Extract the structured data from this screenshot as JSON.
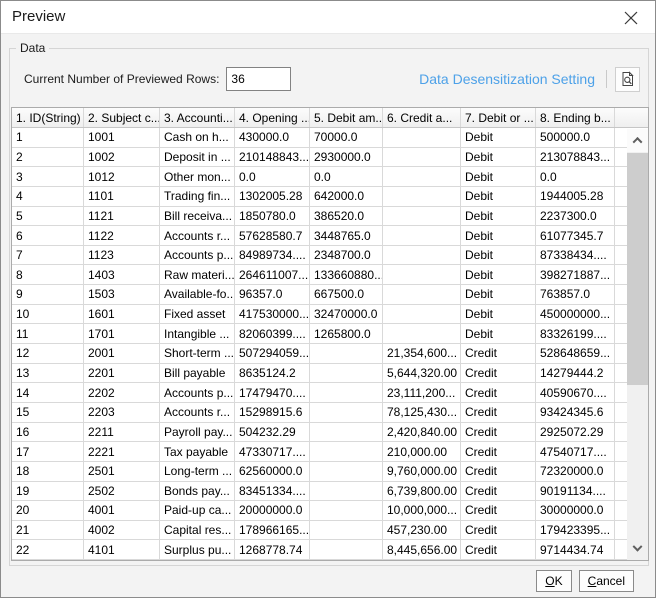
{
  "window": {
    "title": "Preview"
  },
  "groupbox_label": "Data",
  "toolbar": {
    "rows_label": "Current Number of Previewed Rows:",
    "rows_value": "36",
    "desensitization_link": "Data Desensitization Setting"
  },
  "table": {
    "headers": [
      "1. ID(String)",
      "2. Subject c...",
      "3. Accounti...",
      "4. Opening ...",
      "5. Debit am...",
      "6. Credit a...",
      "7. Debit or ...",
      "8. Ending b..."
    ],
    "rows": [
      [
        "1",
        "1001",
        "Cash on h...",
        "430000.0",
        "70000.0",
        "",
        "Debit",
        "500000.0"
      ],
      [
        "2",
        "1002",
        "Deposit in ...",
        "210148843...",
        "2930000.0",
        "",
        "Debit",
        "213078843..."
      ],
      [
        "3",
        "1012",
        "Other mon...",
        "0.0",
        "0.0",
        "",
        "Debit",
        "0.0"
      ],
      [
        "4",
        "1101",
        "Trading fin...",
        "1302005.28",
        "642000.0",
        "",
        "Debit",
        "1944005.28"
      ],
      [
        "5",
        "1121",
        "Bill receiva...",
        "1850780.0",
        "386520.0",
        "",
        "Debit",
        "2237300.0"
      ],
      [
        "6",
        "1122",
        "Accounts r...",
        "57628580.7",
        "3448765.0",
        "",
        "Debit",
        "61077345.7"
      ],
      [
        "7",
        "1123",
        "Accounts p...",
        "84989734....",
        "2348700.0",
        "",
        "Debit",
        "87338434...."
      ],
      [
        "8",
        "1403",
        "Raw materi...",
        "264611007...",
        "133660880...",
        "",
        "Debit",
        "398271887..."
      ],
      [
        "9",
        "1503",
        "Available-fo...",
        "96357.0",
        "667500.0",
        "",
        "Debit",
        "763857.0"
      ],
      [
        "10",
        "1601",
        "Fixed asset",
        "417530000...",
        "32470000.0",
        "",
        "Debit",
        "450000000..."
      ],
      [
        "11",
        "1701",
        "Intangible ...",
        "82060399....",
        "1265800.0",
        "",
        "Debit",
        "83326199...."
      ],
      [
        "12",
        "2001",
        "Short-term ...",
        "507294059...",
        "",
        "21,354,600...",
        "Credit",
        "528648659..."
      ],
      [
        "13",
        "2201",
        "Bill payable",
        "8635124.2",
        "",
        "5,644,320.00",
        "Credit",
        "14279444.2"
      ],
      [
        "14",
        "2202",
        "Accounts p...",
        "17479470....",
        "",
        "23,111,200...",
        "Credit",
        "40590670...."
      ],
      [
        "15",
        "2203",
        "Accounts r...",
        "15298915.6",
        "",
        "78,125,430...",
        "Credit",
        "93424345.6"
      ],
      [
        "16",
        "2211",
        "Payroll pay...",
        "504232.29",
        "",
        "2,420,840.00",
        "Credit",
        "2925072.29"
      ],
      [
        "17",
        "2221",
        "Tax payable",
        "47330717....",
        "",
        "210,000.00",
        "Credit",
        "47540717...."
      ],
      [
        "18",
        "2501",
        "Long-term ...",
        "62560000.0",
        "",
        "9,760,000.00",
        "Credit",
        "72320000.0"
      ],
      [
        "19",
        "2502",
        "Bonds pay...",
        "83451334....",
        "",
        "6,739,800.00",
        "Credit",
        "90191134...."
      ],
      [
        "20",
        "4001",
        "Paid-up ca...",
        "20000000.0",
        "",
        "10,000,000...",
        "Credit",
        "30000000.0"
      ],
      [
        "21",
        "4002",
        "Capital res...",
        "178966165...",
        "",
        "457,230.00",
        "Credit",
        "179423395..."
      ],
      [
        "22",
        "4101",
        "Surplus pu...",
        "1268778.74",
        "",
        "8,445,656.00",
        "Credit",
        "9714434.74"
      ]
    ]
  },
  "buttons": {
    "ok": "OK",
    "cancel": "Cancel"
  },
  "colors": {
    "link_blue": "#4da1e8",
    "header_bg": "#efefef",
    "grid_line": "#d9d9d9"
  }
}
